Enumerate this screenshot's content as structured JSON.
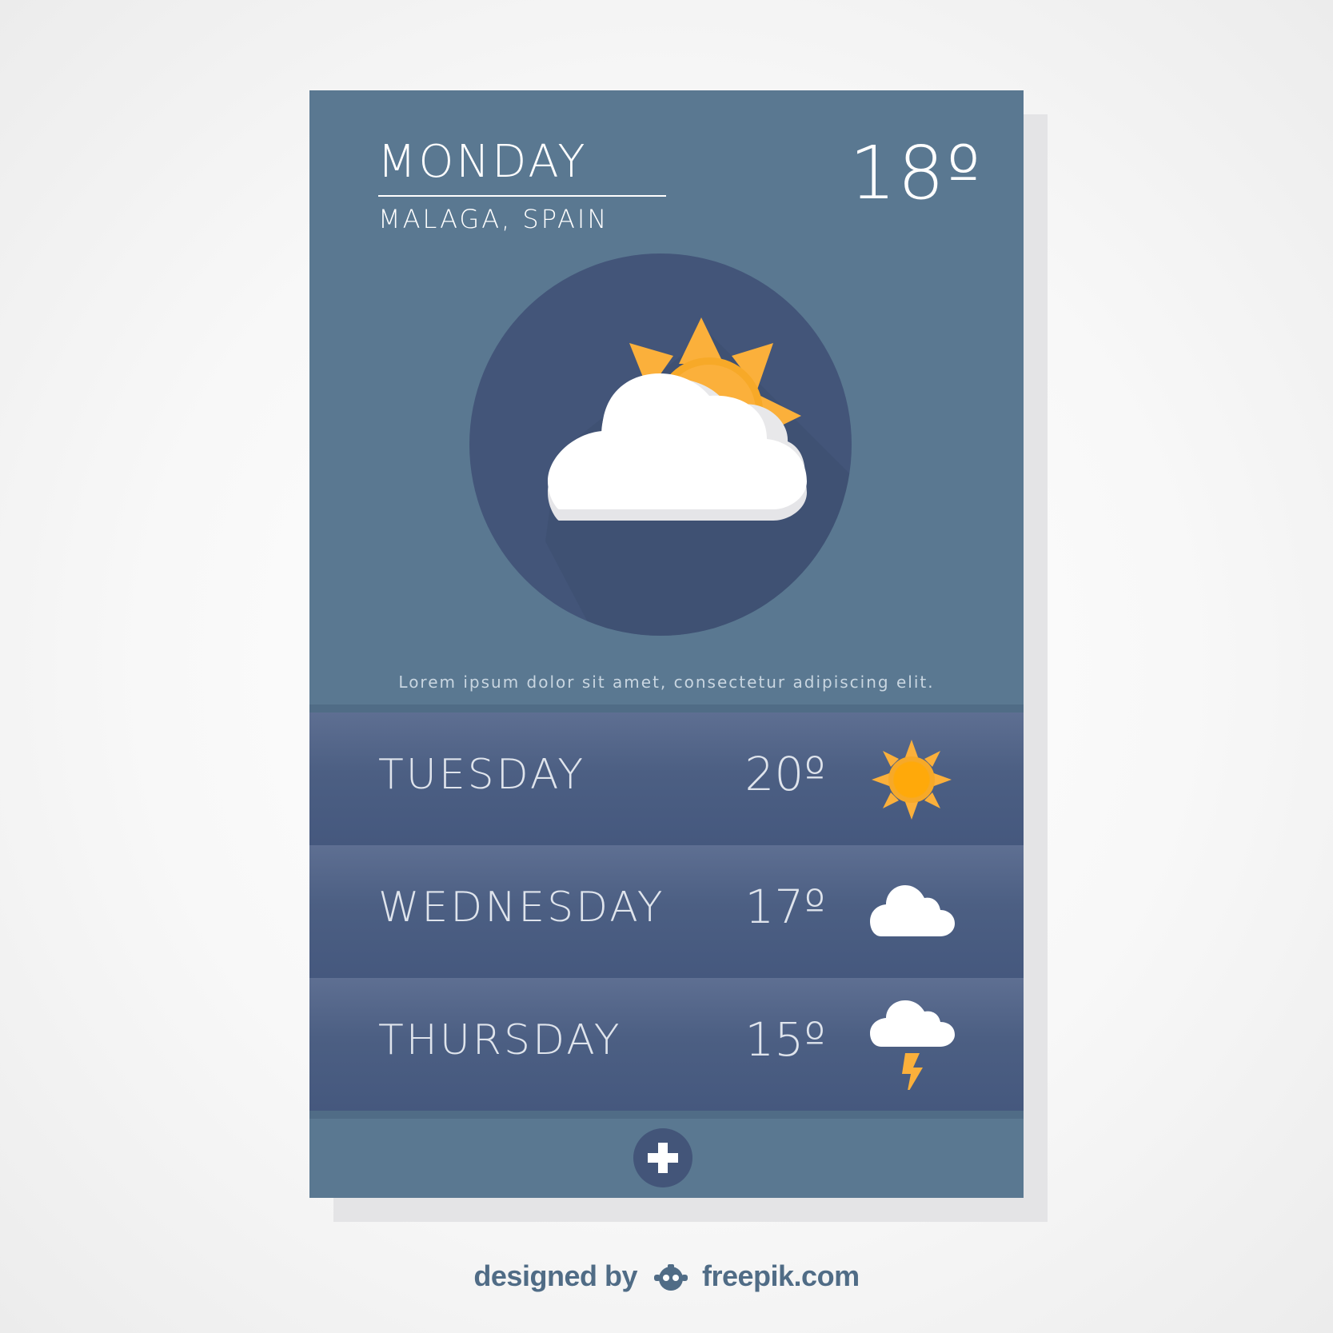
{
  "today": {
    "day": "MONDAY",
    "location": "MALAGA, SPAIN",
    "temperature": "18º",
    "icon": "partly-cloudy-icon",
    "description": "Lorem ipsum dolor sit amet, consectetur adipiscing elit."
  },
  "forecast": [
    {
      "day": "TUESDAY",
      "temperature": "20º",
      "icon": "sun-icon"
    },
    {
      "day": "WEDNESDAY",
      "temperature": "17º",
      "icon": "cloud-icon"
    },
    {
      "day": "THURSDAY",
      "temperature": "15º",
      "icon": "storm-icon"
    }
  ],
  "actions": {
    "add_icon": "plus-icon"
  },
  "credit": {
    "prefix": "designed by",
    "brand": "freepik.com"
  },
  "colors": {
    "card_background": "#5a7891",
    "row_background": "#45587e",
    "circle_background": "#435579",
    "sun_yellow": "#fbb03b",
    "sun_orange": "#f7931e",
    "text_light": "#ffffff",
    "page_background": "#f5f5f5"
  }
}
